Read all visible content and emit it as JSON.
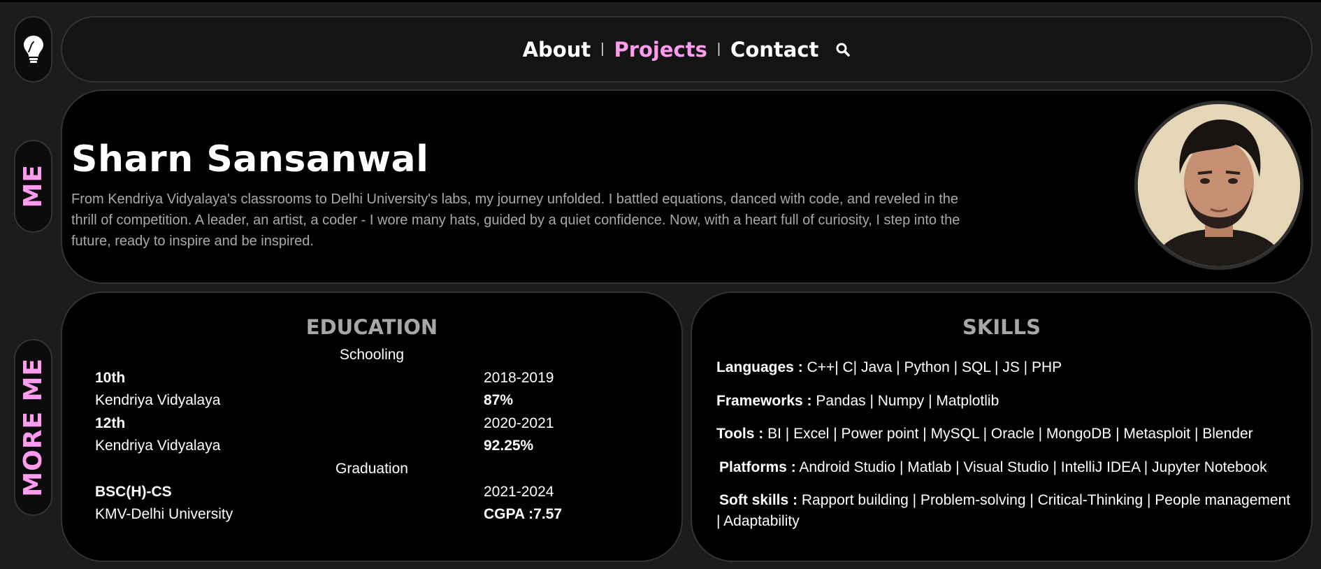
{
  "nav": {
    "links": [
      "About",
      "Projects",
      "Contact"
    ],
    "active_link": "Projects",
    "separator": "|"
  },
  "sidebar": {
    "logo_icon": "lightbulb-icon",
    "me_label": "ME",
    "more_me_label": "MORE ME"
  },
  "hero": {
    "name": "Sharn Sansanwal",
    "bio": "From Kendriya Vidyalaya's classrooms to Delhi University's labs, my journey unfolded. I battled equations, danced with code, and reveled in the thrill of competition. A leader, an artist, a coder - I wore many hats, guided by a quiet confidence. Now, with a heart full of curiosity, I step into the future, ready to inspire and be inspired."
  },
  "education": {
    "title": "EDUCATION",
    "schooling_label": "Schooling",
    "graduation_label": "Graduation",
    "entries": [
      {
        "level": "10th",
        "years": "2018-2019",
        "institution": "Kendriya Vidyalaya",
        "score": "87%"
      },
      {
        "level": "12th",
        "years": "2020-2021",
        "institution": "Kendriya Vidyalaya",
        "score": "92.25%"
      },
      {
        "level": "BSC(H)-CS",
        "years": "2021-2024",
        "institution": "KMV-Delhi University",
        "score": "CGPA :7.57"
      }
    ]
  },
  "skills": {
    "title": "SKILLS",
    "items": [
      {
        "label": "Languages :",
        "value": "C++| C| Java | Python | SQL | JS | PHP"
      },
      {
        "label": "Frameworks :",
        "value": "Pandas | Numpy | Matplotlib"
      },
      {
        "label": "Tools :",
        "value": "BI | Excel | Power point | MySQL | Oracle | MongoDB | Metasploit | Blender"
      },
      {
        "label": "Platforms :",
        "value": "Android Studio | Matlab | Visual Studio | IntelliJ IDEA | Jupyter Notebook"
      },
      {
        "label": "Soft skills :",
        "value": "Rapport building | Problem-solving | Critical-Thinking | People management | Adaptability"
      }
    ]
  },
  "colors": {
    "accent": "#ff9cf0",
    "background": "#1b1b1b",
    "card": "#000000",
    "muted_text": "#a9a9a9"
  }
}
